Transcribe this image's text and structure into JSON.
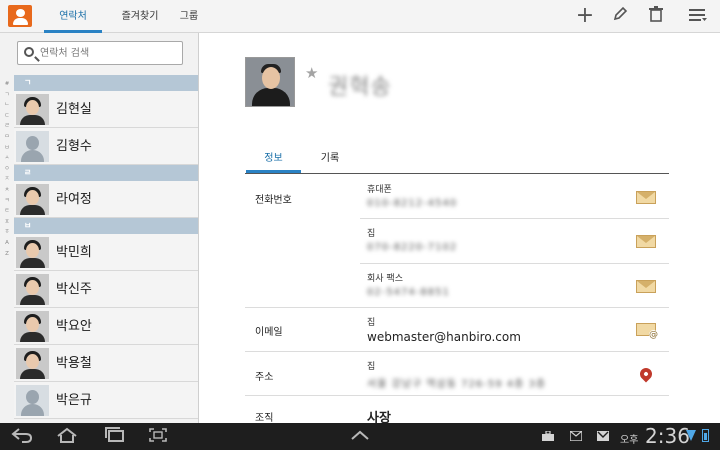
{
  "topbar": {
    "tabs": [
      {
        "label": "연락처"
      },
      {
        "label": "즐겨찾기"
      },
      {
        "label": "그룹"
      }
    ],
    "actions": {
      "add_icon": "plus-icon",
      "edit_icon": "pencil-icon",
      "delete_icon": "trash-icon",
      "menu_icon": "menu-icon"
    }
  },
  "sidebar": {
    "search_placeholder": "연락처 검색",
    "index_letters": [
      "#",
      "ㄱ",
      "ㄴ",
      "ㄷ",
      "ㄹ",
      "ㅁ",
      "ㅂ",
      "ㅅ",
      "ㅇ",
      "ㅈ",
      "ㅊ",
      "ㅋ",
      "ㅌ",
      "ㅍ",
      "ㅎ",
      "A",
      "Z"
    ],
    "sections": [
      {
        "header": "ㄱ"
      },
      {
        "header": "ㄹ"
      },
      {
        "header": "ㅂ"
      }
    ],
    "contacts": [
      {
        "name": "김현실",
        "avatar": "photo"
      },
      {
        "name": "김형수",
        "avatar": "default"
      },
      {
        "name": "라여정",
        "avatar": "photo"
      },
      {
        "name": "박민희",
        "avatar": "photo"
      },
      {
        "name": "박신주",
        "avatar": "photo"
      },
      {
        "name": "박요안",
        "avatar": "photo"
      },
      {
        "name": "박용철",
        "avatar": "photo"
      },
      {
        "name": "박은규",
        "avatar": "default"
      }
    ]
  },
  "detail": {
    "name": "권혁송",
    "tabs": {
      "info": "정보",
      "log": "기록"
    },
    "phone": {
      "label": "전화번호",
      "entries": [
        {
          "type": "휴대폰",
          "value": "010-8212-4540"
        },
        {
          "type": "집",
          "value": "070-8220-7102"
        },
        {
          "type": "회사 팩스",
          "value": "02-5474-8851"
        }
      ]
    },
    "email": {
      "label": "이메일",
      "type": "집",
      "value": "webmaster@hanbiro.com"
    },
    "address": {
      "label": "주소",
      "type": "집",
      "value": "서울 강남구 역삼동 726-59 4층 3층"
    },
    "org": {
      "label": "조직",
      "value": "사장"
    }
  },
  "statusbar": {
    "ampm": "오후",
    "time": "2:36"
  }
}
